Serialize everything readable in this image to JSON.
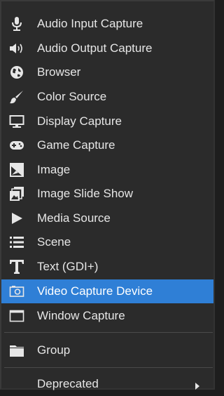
{
  "menu": {
    "items": [
      {
        "label": "Audio Input Capture",
        "icon": "microphone-icon"
      },
      {
        "label": "Audio Output Capture",
        "icon": "speaker-icon"
      },
      {
        "label": "Browser",
        "icon": "globe-icon"
      },
      {
        "label": "Color Source",
        "icon": "paint-brush-icon"
      },
      {
        "label": "Display Capture",
        "icon": "monitor-icon"
      },
      {
        "label": "Game Capture",
        "icon": "gamepad-icon"
      },
      {
        "label": "Image",
        "icon": "image-icon"
      },
      {
        "label": "Image Slide Show",
        "icon": "image-slideshow-icon"
      },
      {
        "label": "Media Source",
        "icon": "play-icon"
      },
      {
        "label": "Scene",
        "icon": "list-icon"
      },
      {
        "label": "Text (GDI+)",
        "icon": "text-icon"
      },
      {
        "label": "Video Capture Device",
        "icon": "camera-icon",
        "selected": true
      },
      {
        "label": "Window Capture",
        "icon": "window-icon"
      }
    ],
    "group": {
      "label": "Group",
      "icon": "folder-icon"
    },
    "deprecated": {
      "label": "Deprecated",
      "icon": "submenu-arrow-icon"
    }
  },
  "colors": {
    "background": "#2b2b2b",
    "text": "#e6e6e6",
    "selected": "#2f7fd6",
    "separator": "#4a4a4a"
  }
}
